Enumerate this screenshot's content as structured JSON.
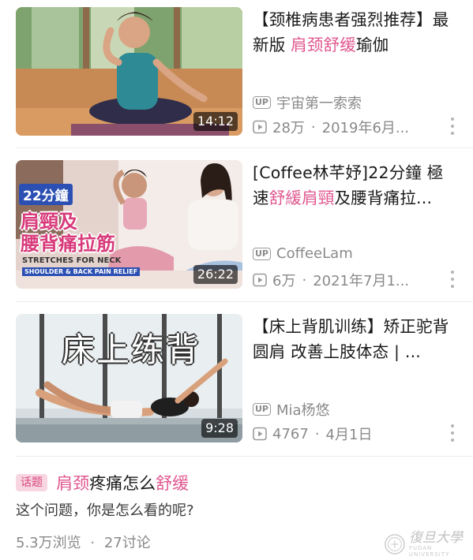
{
  "videos": [
    {
      "title_prefix": "【颈椎病患者强烈推荐】最新版 ",
      "title_highlight": "肩颈舒缓",
      "title_suffix": "瑜伽",
      "duration": "14:12",
      "uploader_badge": "UP",
      "uploader": "宇宙第一索索",
      "views": "28万",
      "date": "2019年6月..."
    },
    {
      "title_prefix": "[Coffee林芊妤]22分鐘 極速",
      "title_highlight": "舒緩肩頸",
      "title_suffix": "及腰背痛拉...",
      "duration": "26:22",
      "uploader_badge": "UP",
      "uploader": "CoffeeLam",
      "views": "6万",
      "date": "2021年7月1...",
      "thumb_text": {
        "minutes": "22分鐘",
        "line1": "肩頸及",
        "line2": "腰背痛拉筋",
        "en1": "STRETCHES FOR NECK",
        "en2": "SHOULDER & BACK PAIN RELIEF"
      }
    },
    {
      "title_prefix": "【床上背肌训练】矫正驼背圆肩 改善上肢体态 | ...",
      "title_highlight": "",
      "title_suffix": "",
      "duration": "9:28",
      "uploader_badge": "UP",
      "uploader": "Mia杨悠",
      "views": "4767",
      "date": "4月1日",
      "thumb_text": {
        "overlay": "床上练背"
      }
    }
  ],
  "meta_separator": "·",
  "topic": {
    "tag": "话题",
    "title_part1": "肩颈",
    "title_part2": "疼痛怎么",
    "title_part3": "舒缓",
    "question": "这个问题，你是怎么看的呢?",
    "views": "5.3万浏览",
    "discussions": "27讨论"
  },
  "watermark": {
    "text_cn": "復旦大學",
    "text_en": "FUDAN UNIVERSITY"
  },
  "colors": {
    "highlight": "#e0578f",
    "meta": "#8a8a8a",
    "tag_bg": "#f7d6e2"
  }
}
